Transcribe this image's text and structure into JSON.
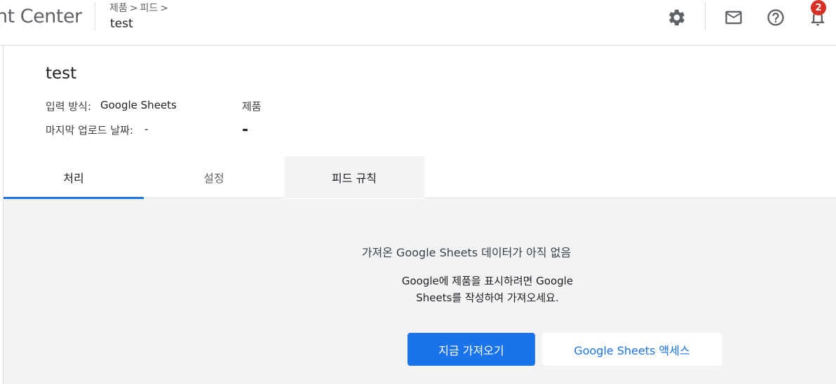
{
  "header": {
    "app_title": "nt Center",
    "breadcrumb": [
      "제품",
      "피드"
    ],
    "breadcrumb_separator": ">",
    "page_title": "test",
    "icons": [
      "gear-icon",
      "mail-icon",
      "help-icon",
      "bell-icon"
    ],
    "notification_count": "2"
  },
  "feed": {
    "title": "test",
    "input_method_label": "입력 방식:",
    "input_method_value": "Google Sheets",
    "last_upload_label": "마지막 업로드 날짜:",
    "last_upload_value": "-",
    "type_label": "제품",
    "type_value": "-"
  },
  "tabs": [
    {
      "label": "처리",
      "active": true
    },
    {
      "label": "설정",
      "active": false
    },
    {
      "label": "피드 규칙",
      "active": false
    }
  ],
  "empty_state": {
    "heading": "가져온 Google Sheets 데이터가 아직 없음",
    "body_line1": "Google에 제품을 표시하려면 Google",
    "body_line2": "Sheets를 작성하여 가져오세요.",
    "primary_button": "지금 가져오기",
    "secondary_button": "Google Sheets 액세스"
  },
  "colors": {
    "accent": "#1a73e8",
    "badge": "#d93025",
    "panel_bg": "#f1f3f4"
  }
}
